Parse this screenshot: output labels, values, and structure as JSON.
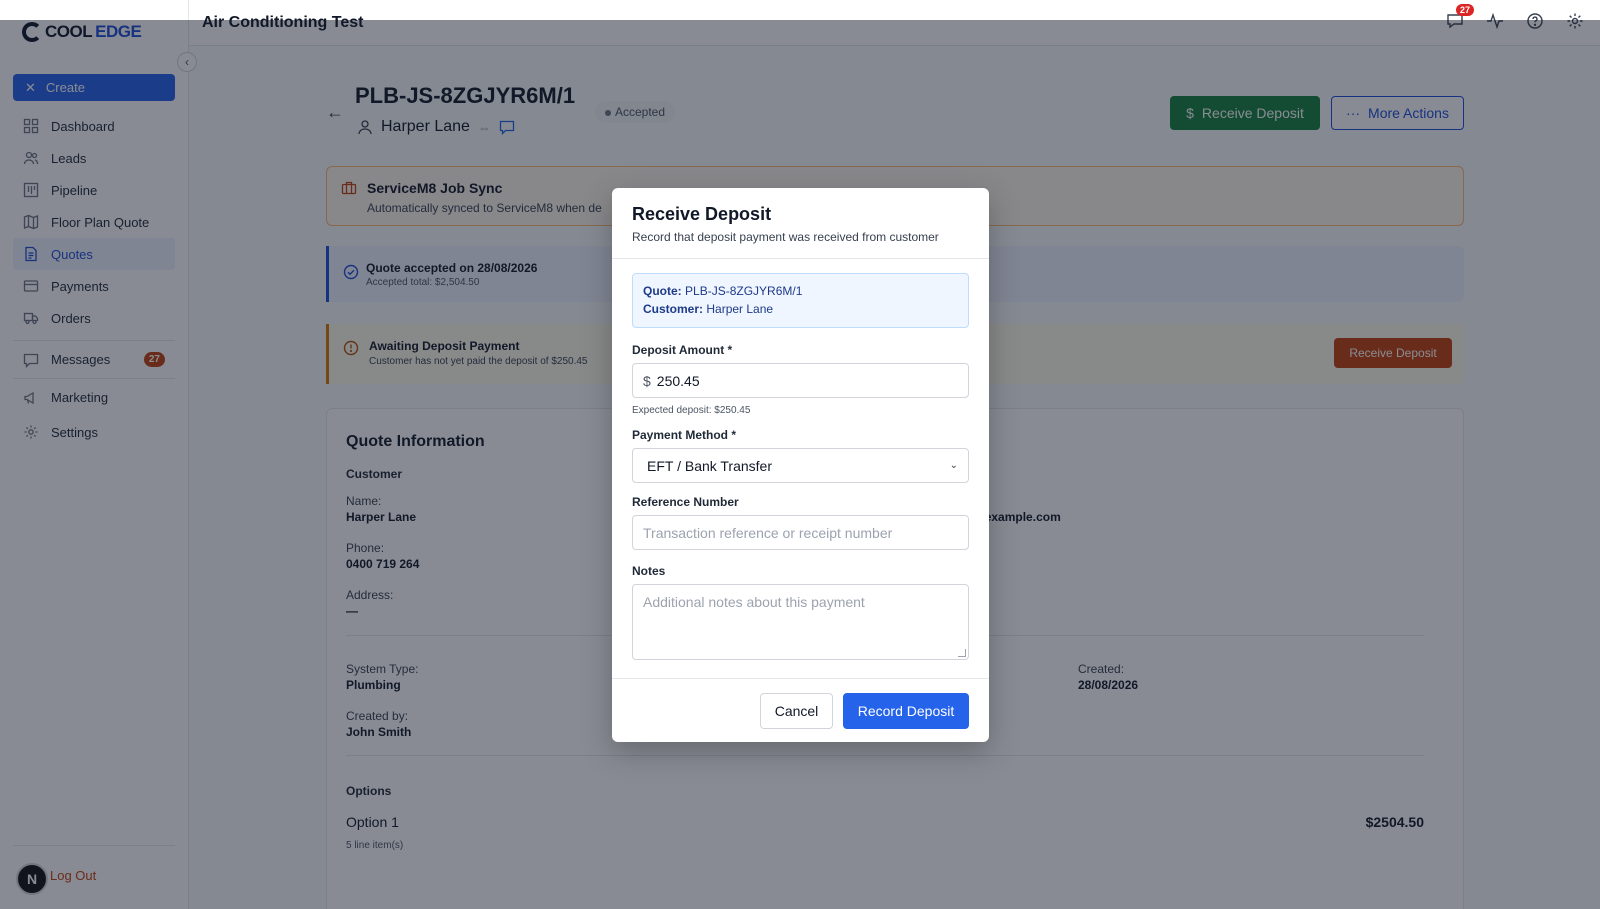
{
  "header": {
    "title": "Air Conditioning Test",
    "notification_count": "27"
  },
  "sidebar": {
    "logo_cool": "COOL",
    "logo_edge": "EDGE",
    "create_label": "Create",
    "items": [
      {
        "label": "Dashboard",
        "icon": "dashboard-icon"
      },
      {
        "label": "Leads",
        "icon": "users-icon"
      },
      {
        "label": "Pipeline",
        "icon": "pipeline-icon"
      },
      {
        "label": "Floor Plan Quote",
        "icon": "map-icon"
      },
      {
        "label": "Quotes",
        "icon": "document-icon",
        "active": true
      },
      {
        "label": "Payments",
        "icon": "credit-card-icon"
      },
      {
        "label": "Orders",
        "icon": "truck-icon"
      },
      {
        "label": "Messages",
        "icon": "message-icon",
        "badge": "27"
      },
      {
        "label": "Marketing",
        "icon": "megaphone-icon"
      },
      {
        "label": "Settings",
        "icon": "gear-icon"
      }
    ],
    "avatar_initial": "N",
    "logout_label": "Log Out"
  },
  "quote": {
    "id": "PLB-JS-8ZGJYR6M/1",
    "customer": "Harper Lane",
    "status": "Accepted",
    "receive_deposit_label": "Receive Deposit",
    "more_actions_label": "More Actions"
  },
  "sync": {
    "title": "ServiceM8 Job Sync",
    "subtitle": "Automatically synced to ServiceM8 when de"
  },
  "accepted": {
    "title": "Quote accepted on 28/08/2026",
    "subtitle": "Accepted total: $2,504.50"
  },
  "awaiting": {
    "title": "Awaiting Deposit Payment",
    "subtitle": "Customer has not yet paid the deposit of $250.45",
    "button": "Receive Deposit"
  },
  "info": {
    "heading": "Quote Information",
    "customer_heading": "Customer",
    "name_label": "Name:",
    "name_value": "Harper Lane",
    "phone_label": "Phone:",
    "phone_value": "0400 719 264",
    "address_label": "Address:",
    "address_value": "—",
    "email_partial": "@example.com",
    "system_type_label": "System Type:",
    "system_type_value": "Plumbing",
    "created_by_label": "Created by:",
    "created_by_value": "John Smith",
    "created_label": "Created:",
    "created_value": "28/08/2026",
    "options_heading": "Options",
    "option_name": "Option 1",
    "option_items": "5 line item(s)",
    "option_total": "$2504.50"
  },
  "modal": {
    "title": "Receive Deposit",
    "subtitle": "Record that deposit payment was received from customer",
    "quote_label": "Quote:",
    "quote_value": "PLB-JS-8ZGJYR6M/1",
    "customer_label": "Customer:",
    "customer_value": "Harper Lane",
    "deposit_label": "Deposit Amount *",
    "currency_symbol": "$",
    "deposit_value": "250.45",
    "deposit_help": "Expected deposit: $250.45",
    "method_label": "Payment Method *",
    "method_value": "EFT / Bank Transfer",
    "reference_label": "Reference Number",
    "reference_placeholder": "Transaction reference or receipt number",
    "notes_label": "Notes",
    "notes_placeholder": "Additional notes about this payment",
    "cancel_label": "Cancel",
    "record_label": "Record Deposit"
  }
}
